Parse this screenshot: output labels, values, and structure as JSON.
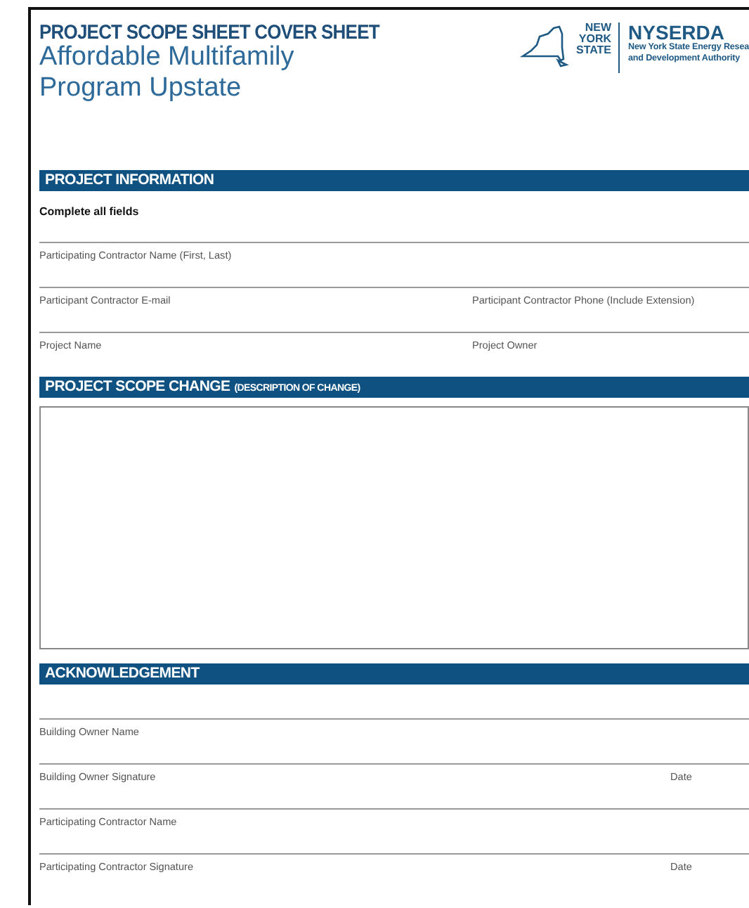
{
  "header": {
    "title": "PROJECT SCOPE SHEET COVER SHEET",
    "subtitle_lines": [
      "Affordable Multifamily",
      "Program Upstate"
    ],
    "logo": {
      "state_words": [
        "NEW",
        "YORK",
        "STATE"
      ],
      "org_name": "NYSERDA",
      "org_lines": [
        "New York State Energy Resea",
        "and Development Authority"
      ]
    }
  },
  "sections": [
    {
      "kind": "fields",
      "title": "PROJECT INFORMATION",
      "instruction": "Complete all fields",
      "rows": [
        {
          "kind": "full",
          "labels": [
            "Participating Contractor Name (First, Last)"
          ]
        },
        {
          "kind": "split",
          "labels": [
            "Participant Contractor E-mail",
            "Participant Contractor Phone (Include Extension)"
          ]
        },
        {
          "kind": "split",
          "labels": [
            "Project Name",
            "Project Owner"
          ]
        }
      ]
    },
    {
      "kind": "textbox",
      "title": "PROJECT SCOPE CHANGE",
      "note": "(DESCRIPTION OF CHANGE)"
    },
    {
      "kind": "fields",
      "title": "ACKNOWLEDGEMENT",
      "rows": [
        {
          "kind": "full",
          "labels": [
            "Building Owner Name"
          ]
        },
        {
          "kind": "signature",
          "labels": [
            "Building Owner Signature",
            "Date"
          ]
        },
        {
          "kind": "full",
          "labels": [
            "Participating Contractor Name"
          ]
        },
        {
          "kind": "signature",
          "labels": [
            "Participating Contractor Signature",
            "Date"
          ]
        }
      ]
    }
  ]
}
